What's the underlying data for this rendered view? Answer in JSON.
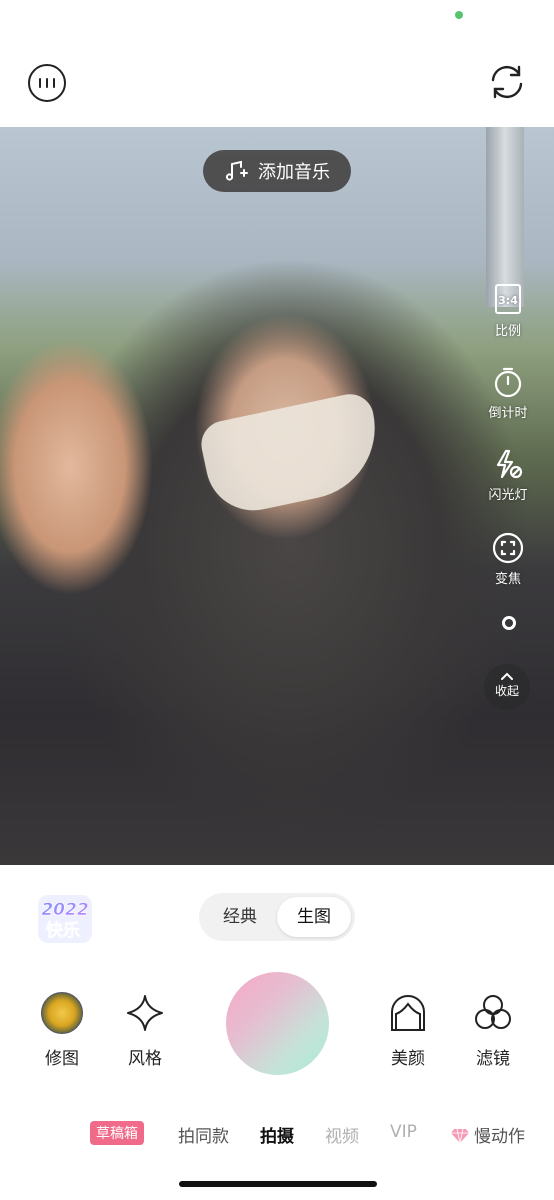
{
  "top": {
    "status_dot_color": "#58c46e",
    "menu_icon": "menu-icon",
    "flip_icon": "camera-flip-icon"
  },
  "viewfinder": {
    "music_label": "添加音乐",
    "side_tools": [
      {
        "icon": "aspect-ratio-icon",
        "badge": "3:4",
        "label": "比例"
      },
      {
        "icon": "timer-icon",
        "label": "倒计时"
      },
      {
        "icon": "flash-off-icon",
        "label": "闪光灯"
      },
      {
        "icon": "zoom-icon",
        "label": "变焦"
      }
    ],
    "collapse_label": "收起"
  },
  "controls": {
    "sticker_text_line1": "2022",
    "sticker_text_line2": "快乐",
    "mode_options": [
      "经典",
      "生图"
    ],
    "mode_selected": "生图",
    "tools_left": [
      {
        "icon": "retouch-icon",
        "label": "修图"
      },
      {
        "icon": "style-sparkle-icon",
        "label": "风格"
      }
    ],
    "tools_right": [
      {
        "icon": "beauty-face-icon",
        "label": "美颜"
      },
      {
        "icon": "filter-icon",
        "label": "滤镜"
      }
    ],
    "shutter_colors": [
      "#f6a8c3",
      "#a7ecd8"
    ]
  },
  "tabs": {
    "draft_box": "草稿箱",
    "items": [
      "拍同款",
      "拍摄",
      "视频",
      "VIP",
      "慢动作"
    ],
    "active": "拍摄"
  }
}
